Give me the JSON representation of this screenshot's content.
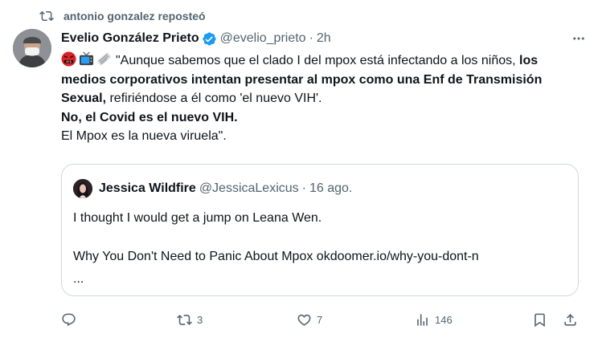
{
  "repost": {
    "text": "antonio gonzalez reposteó"
  },
  "tweet": {
    "author_name": "Evelio González Prieto",
    "handle": "@evelio_prieto",
    "separator": "·",
    "time": "2h",
    "emojis": [
      "angry-symbols-face",
      "television",
      "newspaper"
    ],
    "text_1": "\"Aunque sabemos que el clado I del mpox está infectando a los niños, ",
    "text_2_bold": "los medios corporativos intentan presentar al mpox como una Enf de Transmisión Sexual,",
    "text_3": " refiriéndose a él como 'el nuevo VIH'.",
    "text_4_bold": "No, el Covid es el nuevo VIH.",
    "text_5": "El Mpox es la nueva viruela\"."
  },
  "quote": {
    "author_name": "Jessica Wildfire",
    "handle": "@JessicaLexicus",
    "separator": "·",
    "date": "16 ago.",
    "line1": "I thought I would get a jump on Leana Wen.",
    "line2": "Why You Don't Need to Panic About Mpox okdoomer.io/why-you-dont-n",
    "line3": "..."
  },
  "actions": {
    "reply_count": "",
    "repost_count": "3",
    "like_count": "7",
    "views_count": "146"
  },
  "colors": {
    "text": "#0f1419",
    "secondary": "#536471",
    "verified": "#1d9bf0",
    "border": "#cfd9de"
  },
  "icons": [
    "repost-icon",
    "verified-badge-icon",
    "more-icon",
    "reply-icon",
    "retweet-icon",
    "like-icon",
    "views-icon",
    "bookmark-icon",
    "share-icon"
  ]
}
